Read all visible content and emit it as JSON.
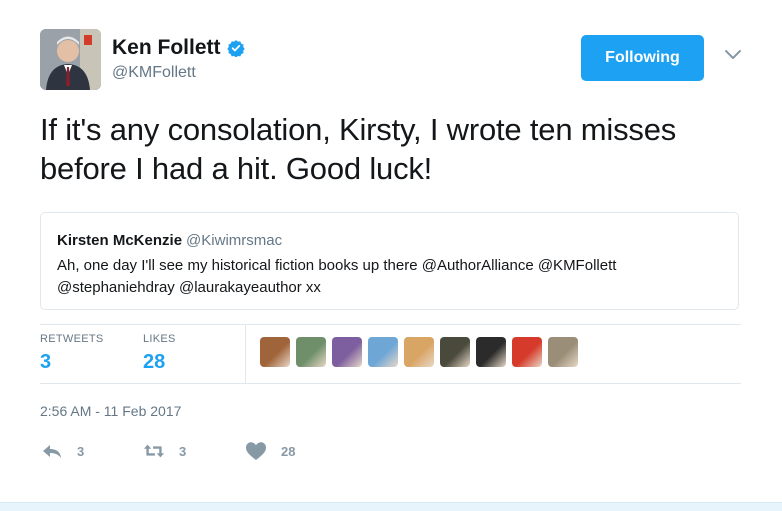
{
  "author": {
    "name": "Ken Follett",
    "handle": "@KMFollett"
  },
  "follow_button": {
    "label": "Following"
  },
  "tweet": {
    "text": "If it's any consolation, Kirsty, I wrote ten misses before I had a hit. Good luck!"
  },
  "quoted_tweet": {
    "name": "Kirsten McKenzie",
    "handle": "@Kiwimrsmac",
    "text": "Ah, one day I'll see my historical fiction books up there @AuthorAlliance @KMFollett @stephaniehdray @laurakayeauthor xx"
  },
  "stats": {
    "retweets_label": "RETWEETS",
    "retweets": "3",
    "likes_label": "LIKES",
    "likes": "28"
  },
  "likers": [
    {
      "name": "liker-avatar-1",
      "color": "#a0643a"
    },
    {
      "name": "liker-avatar-2",
      "color": "#6f8f6a"
    },
    {
      "name": "liker-avatar-3",
      "color": "#7d5e9e"
    },
    {
      "name": "liker-avatar-4",
      "color": "#6ea6d6"
    },
    {
      "name": "liker-avatar-5",
      "color": "#d9a564"
    },
    {
      "name": "liker-avatar-6",
      "color": "#4a4a3c"
    },
    {
      "name": "liker-avatar-7",
      "color": "#2b2b2b"
    },
    {
      "name": "liker-avatar-8",
      "color": "#d63a2a"
    },
    {
      "name": "liker-avatar-9",
      "color": "#9a8e78"
    }
  ],
  "timestamp": "2:56 AM - 11 Feb 2017",
  "actions": {
    "reply_count": "3",
    "retweet_count": "3",
    "like_count": "28"
  },
  "colors": {
    "accent": "#1da1f2",
    "muted": "#657786",
    "icon": "#8899a6"
  }
}
